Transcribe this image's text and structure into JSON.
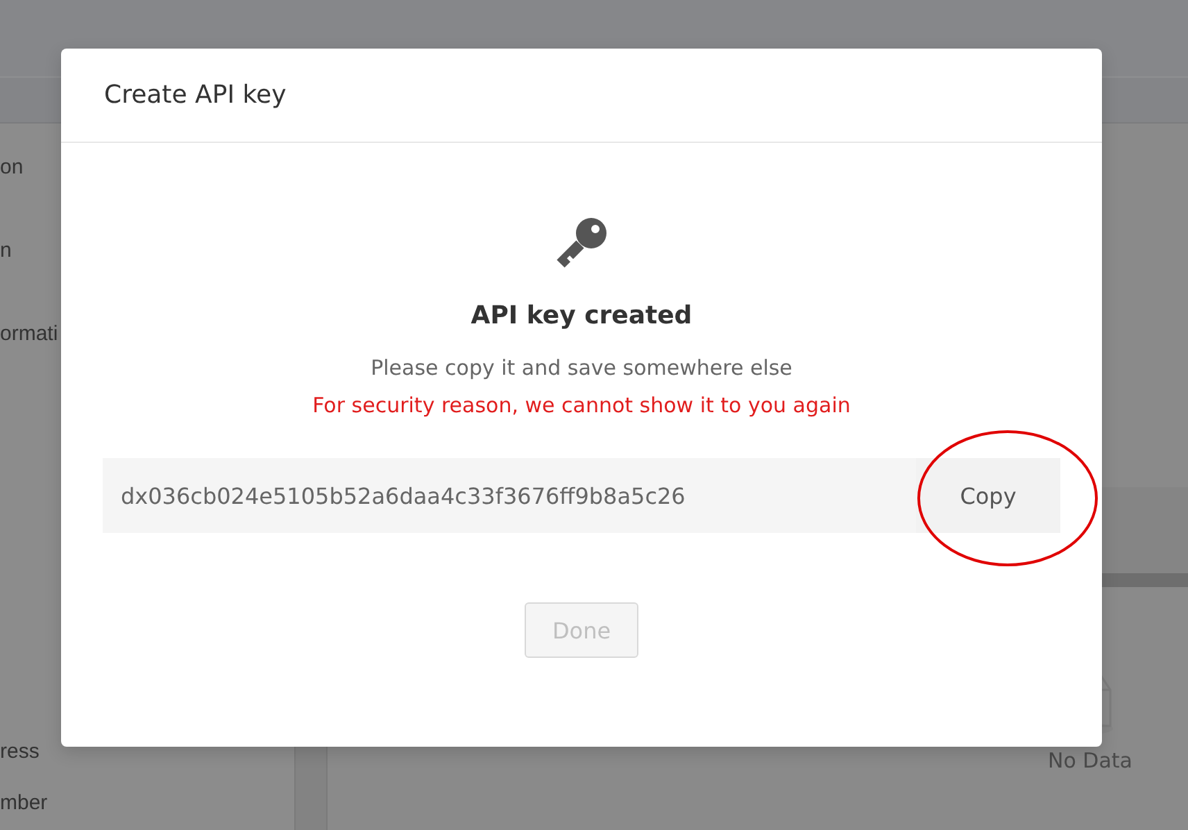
{
  "sidebar": {
    "items": [
      {
        "label": "on"
      },
      {
        "label": "n"
      },
      {
        "label": "ormati"
      },
      {
        "label": "ress"
      },
      {
        "label": "mber"
      }
    ]
  },
  "empty_state": {
    "text": "No Data"
  },
  "dialog": {
    "title": "Create API key",
    "heading": "API key created",
    "message": "Please copy it and save somewhere else",
    "warning": "For security reason, we cannot show it to you again",
    "api_key": "dx036cb024e5105b52a6daa4c33f3676ff9b8a5c26",
    "copy_button": {
      "label": "Copy"
    },
    "done_button": {
      "label": "Done",
      "disabled": true
    }
  }
}
